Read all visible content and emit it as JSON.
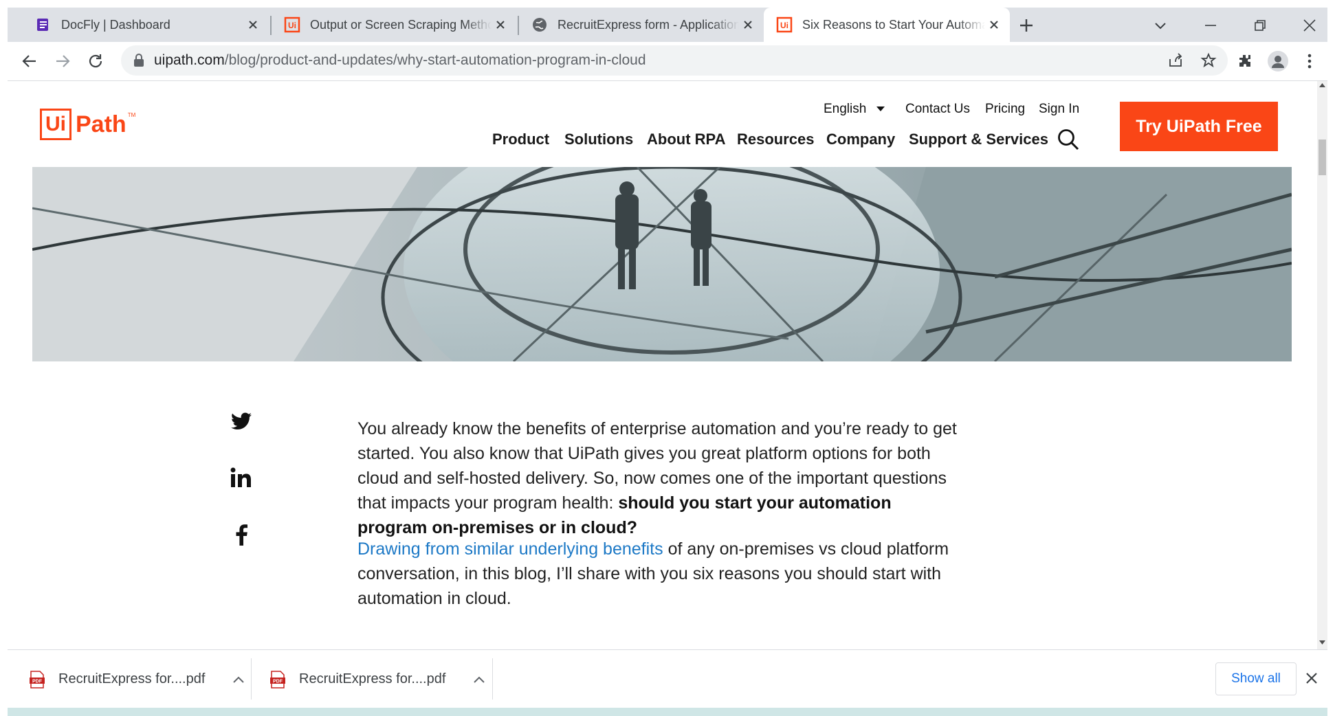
{
  "browser": {
    "tabs": [
      {
        "title": "DocFly | Dashboard",
        "icon": "docfly-icon",
        "active": false
      },
      {
        "title": "Output or Screen Scraping Methods",
        "icon": "uipath-favicon",
        "active": false
      },
      {
        "title": "RecruitExpress form - Application",
        "icon": "globe-icon",
        "active": false
      },
      {
        "title": "Six Reasons to Start Your Automation Program in Cloud",
        "icon": "uipath-favicon",
        "active": true
      }
    ],
    "url_host": "uipath.com",
    "url_path": "/blog/product-and-updates/why-start-automation-program-in-cloud"
  },
  "site": {
    "logo_ui": "Ui",
    "logo_path": "Path",
    "logo_tm": "TM",
    "utility_nav": {
      "language": "English",
      "contact": "Contact Us",
      "pricing": "Pricing",
      "signin": "Sign In"
    },
    "main_nav": [
      "Product",
      "Solutions",
      "About RPA",
      "Resources",
      "Company",
      "Support & Services"
    ],
    "cta": "Try UiPath Free",
    "brand_color": "#fa4616"
  },
  "article": {
    "p1_text": "You already know the benefits of enterprise automation and you’re ready to get started. You also know that UiPath gives you great platform options for both cloud and self-hosted delivery. So, now comes one of the important questions that impacts your program health: ",
    "p1_bold": "should you start your automation program on-premises or in cloud?",
    "p2_link": "Drawing from similar underlying benefits",
    "p2_text": " of any on-premises vs cloud platform conversation, in this blog, I’ll share with you six reasons you should start with automation in cloud.",
    "link_color": "#1d79c6"
  },
  "share_icons": [
    "twitter-icon",
    "linkedin-icon",
    "facebook-icon"
  ],
  "downloads": {
    "items": [
      {
        "filename": "RecruitExpress for....pdf"
      },
      {
        "filename": "RecruitExpress for....pdf"
      }
    ],
    "show_all": "Show all"
  }
}
